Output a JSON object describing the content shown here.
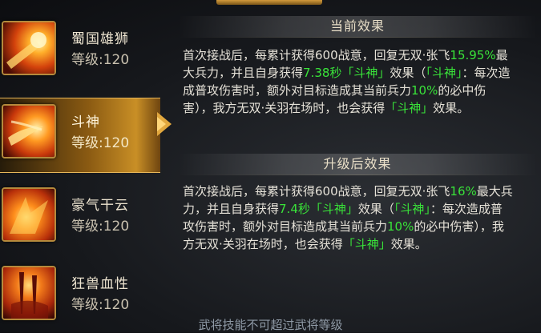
{
  "skills": [
    {
      "name": "蜀国雄狮",
      "level_label": "等级:",
      "level": "120",
      "selected": false,
      "icon": "roaring-lion-fire-icon"
    },
    {
      "name": "斗神",
      "level_label": "等级:",
      "level": "120",
      "selected": true,
      "icon": "flame-comet-icon"
    },
    {
      "name": "豪气干云",
      "level_label": "等级:",
      "level": "120",
      "selected": false,
      "icon": "flame-burst-icon"
    },
    {
      "name": "狂兽血性",
      "level_label": "等级:",
      "level": "120",
      "selected": false,
      "icon": "blood-blades-icon"
    }
  ],
  "current": {
    "title": "当前效果",
    "p1": "首次接战后，每累计获得600战意，回复无双·张飞",
    "v1": "15.95%",
    "p2": "最大兵力，并且自身获得",
    "v2": "7.38秒",
    "p3": "「斗神」",
    "p4": "效果（",
    "p5": "「斗神」",
    "p6": "：每次造成普攻伤害时，额外对目标造成其当前兵力",
    "v3": "10%",
    "p7": "的必中伤害），我方无双·关羽在场时，也会获得",
    "p8": "「斗神」",
    "p9": "效果。"
  },
  "upgraded": {
    "title": "升级后效果",
    "p1": "首次接战后，每累计获得600战意，回复无双·张飞",
    "v1": "16%",
    "p2": "最大兵力，并且自身获得",
    "v2": "7.4秒",
    "p3": "「斗神」",
    "p4": "效果（",
    "p5": "「斗神」",
    "p6": "：每次造成普攻伤害时，额外对目标造成其当前兵力",
    "v3": "10%",
    "p7": "的必中伤害），我方无双·关羽在场时，也会获得",
    "p8": "「斗神」",
    "p9": "效果。"
  },
  "footer": "武将技能不可超过武将等级",
  "colors": {
    "highlight": "#39e339",
    "gold": "#c98f26",
    "text": "#e6e2d8"
  }
}
